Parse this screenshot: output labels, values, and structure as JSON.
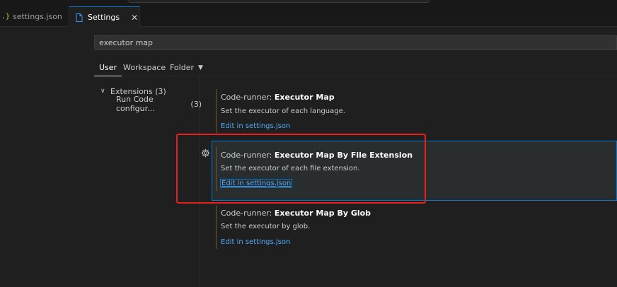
{
  "tabs": [
    {
      "label": "settings.json",
      "icon": "json-braces-icon",
      "active": false
    },
    {
      "label": "Settings",
      "icon": "file-icon",
      "active": true,
      "close": "✕"
    }
  ],
  "search": {
    "value": "executor map"
  },
  "scope_tabs": {
    "user": "User",
    "workspace": "Workspace",
    "folder": "Folder"
  },
  "toc": {
    "group": {
      "label": "Extensions (3)"
    },
    "item": {
      "label": "Run Code configur...",
      "count": "(3)"
    }
  },
  "settings": [
    {
      "category": "Code-runner: ",
      "name": "Executor Map",
      "description": "Set the executor of each language.",
      "link": "Edit in settings.json"
    },
    {
      "category": "Code-runner: ",
      "name": "Executor Map By File Extension",
      "description": "Set the executor of each file extension.",
      "link": "Edit in settings.json",
      "focused": true
    },
    {
      "category": "Code-runner: ",
      "name": "Executor Map By Glob",
      "description": "Set the executor by glob.",
      "link": "Edit in settings.json"
    }
  ],
  "colors": {
    "accent": "#0078d4",
    "link": "#4daafc",
    "annotation": "#e5201d",
    "modified_rail": "#6b5b2a"
  }
}
